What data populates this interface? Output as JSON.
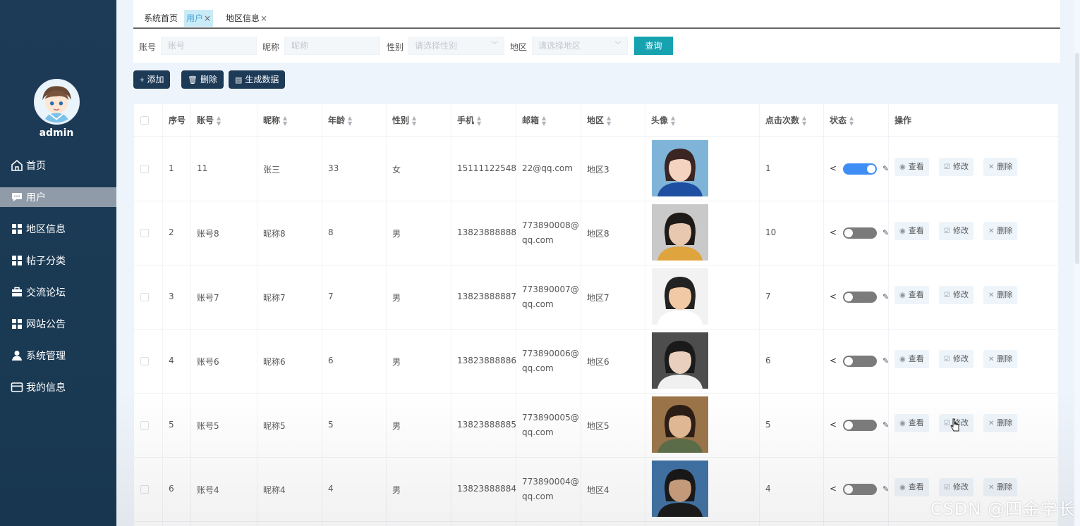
{
  "sidebar": {
    "username": "admin",
    "items": [
      {
        "label": "首页",
        "icon": "home-icon"
      },
      {
        "label": "用户",
        "icon": "chat-icon",
        "active": true
      },
      {
        "label": "地区信息",
        "icon": "grid-icon"
      },
      {
        "label": "帖子分类",
        "icon": "grid-icon"
      },
      {
        "label": "交流论坛",
        "icon": "briefcase-icon"
      },
      {
        "label": "网站公告",
        "icon": "grid-icon"
      },
      {
        "label": "系统管理",
        "icon": "user-icon"
      },
      {
        "label": "我的信息",
        "icon": "card-icon"
      }
    ]
  },
  "tabs": [
    {
      "label": "系统首页"
    },
    {
      "label": "用户",
      "close": "×",
      "active": true
    },
    {
      "label": "地区信息",
      "close": "×"
    }
  ],
  "search": {
    "account_label": "账号",
    "account_placeholder": "账号",
    "nickname_label": "昵称",
    "nickname_placeholder": "昵称",
    "gender_label": "性别",
    "gender_placeholder": "请选择性别",
    "region_label": "地区",
    "region_placeholder": "请选择地区",
    "query_button": "查询"
  },
  "actions": {
    "add": "添加",
    "add_icon": "+",
    "delete": "删除",
    "generate": "生成数据"
  },
  "table": {
    "headers": {
      "index": "序号",
      "account": "账号",
      "nickname": "昵称",
      "age": "年龄",
      "gender": "性别",
      "phone": "手机",
      "email": "邮箱",
      "region": "地区",
      "avatar": "头像",
      "clicks": "点击次数",
      "status": "状态",
      "ops": "操作"
    },
    "op_labels": {
      "view": "查看",
      "edit": "修改",
      "delete": "删除"
    },
    "rows": [
      {
        "index": "1",
        "account": "11",
        "nickname": "张三",
        "age": "33",
        "gender": "女",
        "phone": "15111122548",
        "email_1": "22@qq.com",
        "email_2": "",
        "region": "地区3",
        "clicks": "1",
        "status_on": true
      },
      {
        "index": "2",
        "account": "账号8",
        "nickname": "昵称8",
        "age": "8",
        "gender": "男",
        "phone": "13823888888",
        "email_1": "773890008@",
        "email_2": "qq.com",
        "region": "地区8",
        "clicks": "10",
        "status_on": false
      },
      {
        "index": "3",
        "account": "账号7",
        "nickname": "昵称7",
        "age": "7",
        "gender": "男",
        "phone": "13823888887",
        "email_1": "773890007@",
        "email_2": "qq.com",
        "region": "地区7",
        "clicks": "7",
        "status_on": false
      },
      {
        "index": "4",
        "account": "账号6",
        "nickname": "昵称6",
        "age": "6",
        "gender": "男",
        "phone": "13823888886",
        "email_1": "773890006@",
        "email_2": "qq.com",
        "region": "地区6",
        "clicks": "6",
        "status_on": false
      },
      {
        "index": "5",
        "account": "账号5",
        "nickname": "昵称5",
        "age": "5",
        "gender": "男",
        "phone": "13823888885",
        "email_1": "773890005@",
        "email_2": "qq.com",
        "region": "地区5",
        "clicks": "5",
        "status_on": false
      },
      {
        "index": "6",
        "account": "账号4",
        "nickname": "昵称4",
        "age": "4",
        "gender": "男",
        "phone": "13823888884",
        "email_1": "773890004@",
        "email_2": "qq.com",
        "region": "地区4",
        "clicks": "4",
        "status_on": false
      }
    ]
  },
  "watermark": "CSDN @四金学长",
  "colors": {
    "sidebar": "#1d3a57",
    "accent": "#17a2b0",
    "toggle_on": "#3f8ef5"
  }
}
